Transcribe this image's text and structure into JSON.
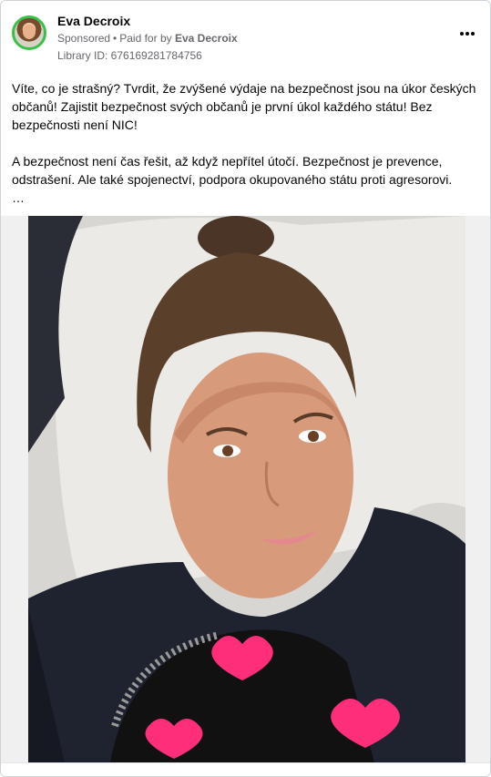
{
  "post": {
    "author_name": "Eva Decroix",
    "sponsored_label": "Sponsored",
    "separator": "•",
    "paid_for_label": "Paid for by",
    "paid_for_name": "Eva Decroix",
    "library_id": "Library ID: 676169281784756",
    "more_icon": "more-options-icon",
    "text": "Víte, co je strašný? Tvrdit, že zvýšené výdaje na bezpečnost jsou na úkor českých občanů! Zajistit bezpečnost svých občanů je první úkol každého státu! Bez bezpečnosti není NIC!\n\nA bezpečnost není čas řešit, až když nepřítel útočí. Bezpečnost je prevence, odstrašení. Ale také spojenectví, podpora okupovaného státu proti agresorovi.\n…"
  },
  "colors": {
    "avatar_ring": "#36c24a",
    "text_primary": "#050505",
    "text_secondary": "#65676b"
  }
}
